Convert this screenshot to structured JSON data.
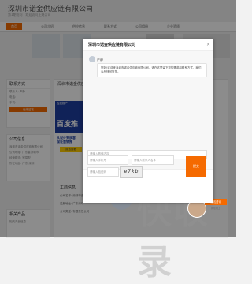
{
  "site": {
    "title": "深圳市诺金供应链有限公司",
    "subtitle": "第1期访问 · 欢迎访问正规公司"
  },
  "nav": {
    "items": [
      "首页",
      "公司介绍",
      "供应信息",
      "联系方式",
      "公司相册",
      "企业资质"
    ]
  },
  "left": {
    "contact_title": "联系方式",
    "contact_lines": [
      "联系人: 严静",
      "电话: ",
      "手机: "
    ],
    "contact_button": "在线留言",
    "company_title": "公司信息",
    "company_lines": [
      "深圳市诺金供应链有限公司",
      "公司地址: 广东省深圳市",
      "经营模式: 贸易型",
      "所在地区: 广东,深圳"
    ],
    "products_title": "相关产品",
    "products_lines": [
      "相关产品信息"
    ]
  },
  "main": {
    "section_title": "深圳市诺金供应链",
    "ad": {
      "top_text": "百度推广",
      "brand": "百度推",
      "line1": "从设计到获客",
      "line2": "保证营销推",
      "button": "点击查看"
    },
    "biz_title": "工商信息",
    "biz_rows": [
      "公司名称: 深圳市诺金供应链有限公司",
      "注册地址: 广东深圳",
      "公司类型: 有限责任公司"
    ]
  },
  "watermark": {
    "text": "快收录"
  },
  "chat_badge": {
    "button": "在线咨询",
    "sub": "我在线上"
  },
  "modal": {
    "title": "深圳市诺金供应链有限公司",
    "close": "×",
    "sender": "严静",
    "message": "您好!欢迎来深圳市诺金供应链有限公司，请在这里留下您的需求和联系方式，我们会尽快回复您。",
    "message_placeholder": "请输入具体内容",
    "phone_placeholder": "请输入手机号",
    "name_placeholder": "请输入联系人名字",
    "captcha_placeholder": "请输入验证码",
    "captcha_text": "e7kb",
    "submit": "提交"
  },
  "colors": {
    "accent": "#f56a00",
    "ad_blue": "#1e3fa0"
  }
}
